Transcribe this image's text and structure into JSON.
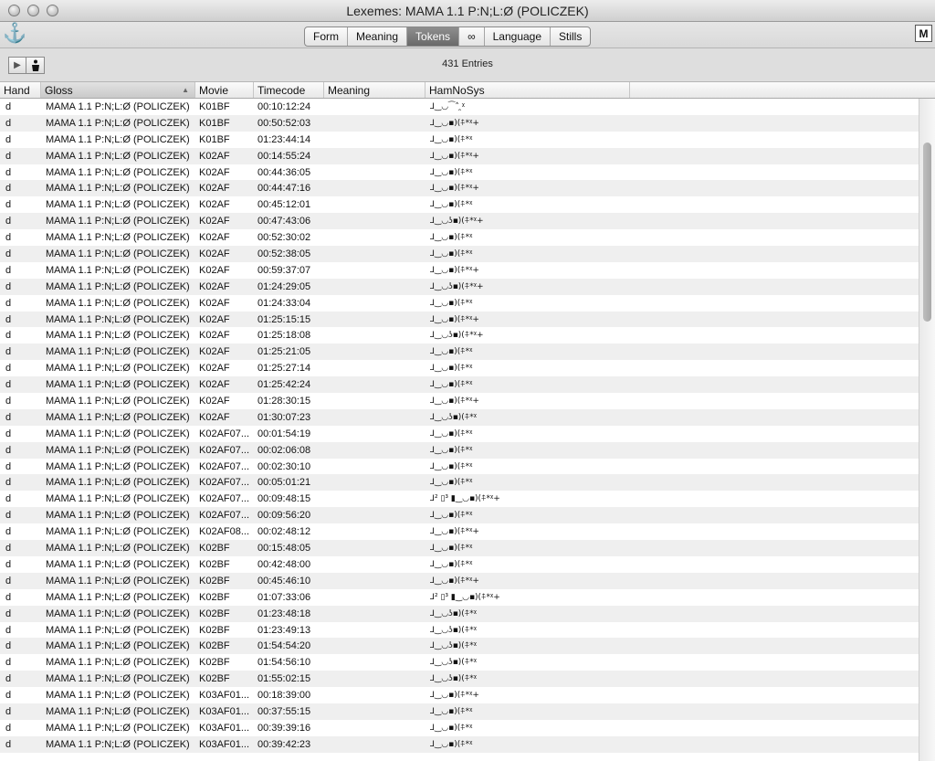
{
  "window": {
    "title": "Lexemes: MAMA 1.1 P:N;L:Ø (POLICZEK)"
  },
  "toolbar": {
    "anchor_glyph": "⚓",
    "m_label": "M",
    "tabs": [
      {
        "label": "Form"
      },
      {
        "label": "Meaning"
      },
      {
        "label": "Tokens",
        "active": true
      },
      {
        "label": "∞"
      },
      {
        "label": "Language"
      },
      {
        "label": "Stills"
      }
    ]
  },
  "infobar": {
    "entries": "431 Entries",
    "play_icon": "play-icon",
    "figure_icon": "signer-figure-icon"
  },
  "table": {
    "columns": [
      "Hand",
      "Gloss",
      "Movie",
      "Timecode",
      "Meaning",
      "HamNoSys"
    ],
    "sorted_column": "Gloss",
    "rows": [
      {
        "hand": "d",
        "gloss": "MAMA 1.1 P:N;L:Ø (POLICZEK)",
        "movie": "K01BF",
        "timecode": "00:10:12:24",
        "meaning": "",
        "hamnosys": "⅃‿◡⁀˄ ̯ᵡ"
      },
      {
        "hand": "d",
        "gloss": "MAMA 1.1 P:N;L:Ø (POLICZEK)",
        "movie": "K01BF",
        "timecode": "00:50:52:03",
        "meaning": "",
        "hamnosys": "⅃‿◡▪)(⍏*ᵡ+"
      },
      {
        "hand": "d",
        "gloss": "MAMA 1.1 P:N;L:Ø (POLICZEK)",
        "movie": "K01BF",
        "timecode": "01:23:44:14",
        "meaning": "",
        "hamnosys": "⅃‿◡▪)(⍏*ᵡ"
      },
      {
        "hand": "d",
        "gloss": "MAMA 1.1 P:N;L:Ø (POLICZEK)",
        "movie": "K02AF",
        "timecode": "00:14:55:24",
        "meaning": "",
        "hamnosys": "⅃‿◡▪)(⍏*ᵡ+"
      },
      {
        "hand": "d",
        "gloss": "MAMA 1.1 P:N;L:Ø (POLICZEK)",
        "movie": "K02AF",
        "timecode": "00:44:36:05",
        "meaning": "",
        "hamnosys": "⅃‿◡▪)(⍏*ᵡ"
      },
      {
        "hand": "d",
        "gloss": "MAMA 1.1 P:N;L:Ø (POLICZEK)",
        "movie": "K02AF",
        "timecode": "00:44:47:16",
        "meaning": "",
        "hamnosys": "⅃‿◡▪)(⍏*ᵡ+"
      },
      {
        "hand": "d",
        "gloss": "MAMA 1.1 P:N;L:Ø (POLICZEK)",
        "movie": "K02AF",
        "timecode": "00:45:12:01",
        "meaning": "",
        "hamnosys": "⅃‿◡▪)(⍏*ᵡ"
      },
      {
        "hand": "d",
        "gloss": "MAMA 1.1 P:N;L:Ø (POLICZEK)",
        "movie": "K02AF",
        "timecode": "00:47:43:06",
        "meaning": "",
        "hamnosys": "⅃‿◡ʖ▪)(⍏*ᵡ+"
      },
      {
        "hand": "d",
        "gloss": "MAMA 1.1 P:N;L:Ø (POLICZEK)",
        "movie": "K02AF",
        "timecode": "00:52:30:02",
        "meaning": "",
        "hamnosys": "⅃‿◡▪)(⍏*ᵡ"
      },
      {
        "hand": "d",
        "gloss": "MAMA 1.1 P:N;L:Ø (POLICZEK)",
        "movie": "K02AF",
        "timecode": "00:52:38:05",
        "meaning": "",
        "hamnosys": "⅃‿◡▪)(⍏*ᵡ"
      },
      {
        "hand": "d",
        "gloss": "MAMA 1.1 P:N;L:Ø (POLICZEK)",
        "movie": "K02AF",
        "timecode": "00:59:37:07",
        "meaning": "",
        "hamnosys": "⅃‿◡▪)(⍏*ᵡ+"
      },
      {
        "hand": "d",
        "gloss": "MAMA 1.1 P:N;L:Ø (POLICZEK)",
        "movie": "K02AF",
        "timecode": "01:24:29:05",
        "meaning": "",
        "hamnosys": "⅃‿◡ʖ▪)(⍏*ᵡ+"
      },
      {
        "hand": "d",
        "gloss": "MAMA 1.1 P:N;L:Ø (POLICZEK)",
        "movie": "K02AF",
        "timecode": "01:24:33:04",
        "meaning": "",
        "hamnosys": "⅃‿◡▪)(⍏*ᵡ"
      },
      {
        "hand": "d",
        "gloss": "MAMA 1.1 P:N;L:Ø (POLICZEK)",
        "movie": "K02AF",
        "timecode": "01:25:15:15",
        "meaning": "",
        "hamnosys": "⅃‿◡▪)(⍏*ᵡ+"
      },
      {
        "hand": "d",
        "gloss": "MAMA 1.1 P:N;L:Ø (POLICZEK)",
        "movie": "K02AF",
        "timecode": "01:25:18:08",
        "meaning": "",
        "hamnosys": "⅃‿◡ʖ▪)(⍏*ᵡ+"
      },
      {
        "hand": "d",
        "gloss": "MAMA 1.1 P:N;L:Ø (POLICZEK)",
        "movie": "K02AF",
        "timecode": "01:25:21:05",
        "meaning": "",
        "hamnosys": "⅃‿◡▪)(⍏*ᵡ"
      },
      {
        "hand": "d",
        "gloss": "MAMA 1.1 P:N;L:Ø (POLICZEK)",
        "movie": "K02AF",
        "timecode": "01:25:27:14",
        "meaning": "",
        "hamnosys": "⅃‿◡▪)(⍏*ᵡ"
      },
      {
        "hand": "d",
        "gloss": "MAMA 1.1 P:N;L:Ø (POLICZEK)",
        "movie": "K02AF",
        "timecode": "01:25:42:24",
        "meaning": "",
        "hamnosys": "⅃‿◡▪)(⍏*ᵡ"
      },
      {
        "hand": "d",
        "gloss": "MAMA 1.1 P:N;L:Ø (POLICZEK)",
        "movie": "K02AF",
        "timecode": "01:28:30:15",
        "meaning": "",
        "hamnosys": "⅃‿◡▪)(⍏*ᵡ+"
      },
      {
        "hand": "d",
        "gloss": "MAMA 1.1 P:N;L:Ø (POLICZEK)",
        "movie": "K02AF",
        "timecode": "01:30:07:23",
        "meaning": "",
        "hamnosys": "⅃‿◡ʖ▪)(⍏*ᵡ"
      },
      {
        "hand": "d",
        "gloss": "MAMA 1.1 P:N;L:Ø (POLICZEK)",
        "movie": "K02AF07...",
        "timecode": "00:01:54:19",
        "meaning": "",
        "hamnosys": "⅃‿◡▪)(⍏*ᵡ"
      },
      {
        "hand": "d",
        "gloss": "MAMA 1.1 P:N;L:Ø (POLICZEK)",
        "movie": "K02AF07...",
        "timecode": "00:02:06:08",
        "meaning": "",
        "hamnosys": "⅃‿◡▪)(⍏*ᵡ"
      },
      {
        "hand": "d",
        "gloss": "MAMA 1.1 P:N;L:Ø (POLICZEK)",
        "movie": "K02AF07...",
        "timecode": "00:02:30:10",
        "meaning": "",
        "hamnosys": "⅃‿◡▪)(⍏*ᵡ"
      },
      {
        "hand": "d",
        "gloss": "MAMA 1.1 P:N;L:Ø (POLICZEK)",
        "movie": "K02AF07...",
        "timecode": "00:05:01:21",
        "meaning": "",
        "hamnosys": "⅃‿◡▪)(⍏*ᵡ"
      },
      {
        "hand": "d",
        "gloss": "MAMA 1.1 P:N;L:Ø (POLICZEK)",
        "movie": "K02AF07...",
        "timecode": "00:09:48:15",
        "meaning": "",
        "hamnosys": "⅃² ▯³ ▮‿◡▪)(⍏*ᵡ+"
      },
      {
        "hand": "d",
        "gloss": "MAMA 1.1 P:N;L:Ø (POLICZEK)",
        "movie": "K02AF07...",
        "timecode": "00:09:56:20",
        "meaning": "",
        "hamnosys": "⅃‿◡▪)(⍏*ᵡ"
      },
      {
        "hand": "d",
        "gloss": "MAMA 1.1 P:N;L:Ø (POLICZEK)",
        "movie": "K02AF08...",
        "timecode": "00:02:48:12",
        "meaning": "",
        "hamnosys": "⅃‿◡▪)(⍏*ᵡ+"
      },
      {
        "hand": "d",
        "gloss": "MAMA 1.1 P:N;L:Ø (POLICZEK)",
        "movie": "K02BF",
        "timecode": "00:15:48:05",
        "meaning": "",
        "hamnosys": "⅃‿◡▪)(⍏*ᵡ"
      },
      {
        "hand": "d",
        "gloss": "MAMA 1.1 P:N;L:Ø (POLICZEK)",
        "movie": "K02BF",
        "timecode": "00:42:48:00",
        "meaning": "",
        "hamnosys": "⅃‿◡▪)(⍏*ᵡ"
      },
      {
        "hand": "d",
        "gloss": "MAMA 1.1 P:N;L:Ø (POLICZEK)",
        "movie": "K02BF",
        "timecode": "00:45:46:10",
        "meaning": "",
        "hamnosys": "⅃‿◡▪)(⍏*ᵡ+"
      },
      {
        "hand": "d",
        "gloss": "MAMA 1.1 P:N;L:Ø (POLICZEK)",
        "movie": "K02BF",
        "timecode": "01:07:33:06",
        "meaning": "",
        "hamnosys": "⅃² ▯³ ▮‿◡▪)(⍏*ᵡ+"
      },
      {
        "hand": "d",
        "gloss": "MAMA 1.1 P:N;L:Ø (POLICZEK)",
        "movie": "K02BF",
        "timecode": "01:23:48:18",
        "meaning": "",
        "hamnosys": "⅃‿◡ʖ▪)(⍏*ᵡ"
      },
      {
        "hand": "d",
        "gloss": "MAMA 1.1 P:N;L:Ø (POLICZEK)",
        "movie": "K02BF",
        "timecode": "01:23:49:13",
        "meaning": "",
        "hamnosys": "⅃‿◡ʖ▪)(⍏*ᵡ"
      },
      {
        "hand": "d",
        "gloss": "MAMA 1.1 P:N;L:Ø (POLICZEK)",
        "movie": "K02BF",
        "timecode": "01:54:54:20",
        "meaning": "",
        "hamnosys": "⅃‿◡ʖ▪)(⍏*ᵡ"
      },
      {
        "hand": "d",
        "gloss": "MAMA 1.1 P:N;L:Ø (POLICZEK)",
        "movie": "K02BF",
        "timecode": "01:54:56:10",
        "meaning": "",
        "hamnosys": "⅃‿◡ʖ▪)(⍏*ᵡ"
      },
      {
        "hand": "d",
        "gloss": "MAMA 1.1 P:N;L:Ø (POLICZEK)",
        "movie": "K02BF",
        "timecode": "01:55:02:15",
        "meaning": "",
        "hamnosys": "⅃‿◡ʖ▪)(⍏*ᵡ"
      },
      {
        "hand": "d",
        "gloss": "MAMA 1.1 P:N;L:Ø (POLICZEK)",
        "movie": "K03AF01...",
        "timecode": "00:18:39:00",
        "meaning": "",
        "hamnosys": "⅃‿◡▪)(⍏*ᵡ+"
      },
      {
        "hand": "d",
        "gloss": "MAMA 1.1 P:N;L:Ø (POLICZEK)",
        "movie": "K03AF01...",
        "timecode": "00:37:55:15",
        "meaning": "",
        "hamnosys": "⅃‿◡▪)(⍏*ᵡ"
      },
      {
        "hand": "d",
        "gloss": "MAMA 1.1 P:N;L:Ø (POLICZEK)",
        "movie": "K03AF01...",
        "timecode": "00:39:39:16",
        "meaning": "",
        "hamnosys": "⅃‿◡▪)(⍏*ᵡ"
      },
      {
        "hand": "d",
        "gloss": "MAMA 1.1 P:N;L:Ø (POLICZEK)",
        "movie": "K03AF01...",
        "timecode": "00:39:42:23",
        "meaning": "",
        "hamnosys": "⅃‿◡▪)(⍏*ᵡ"
      }
    ]
  }
}
